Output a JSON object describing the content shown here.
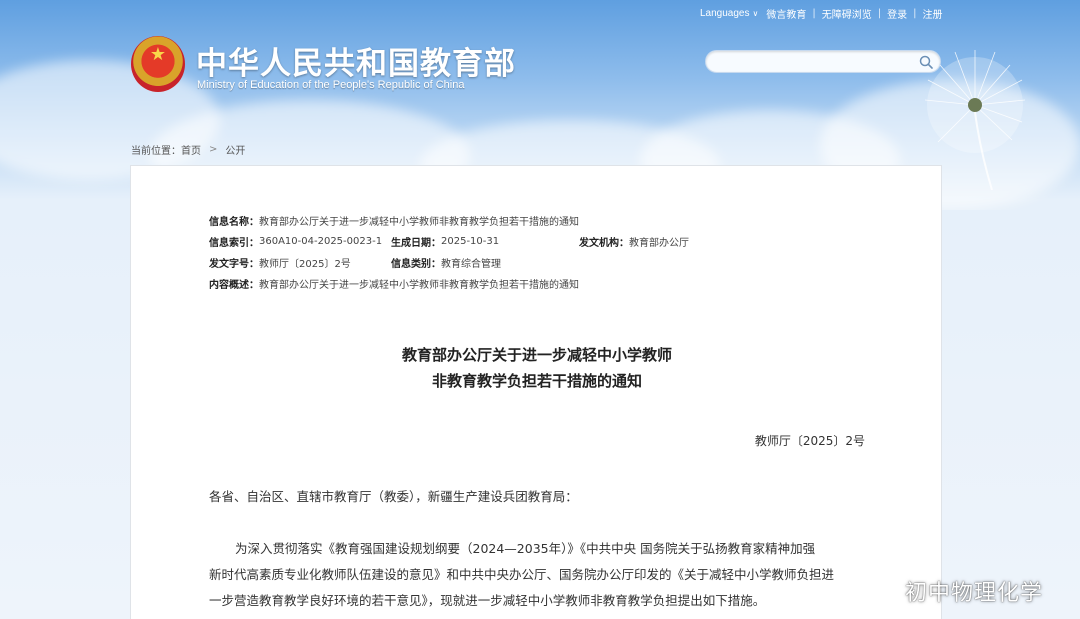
{
  "header": {
    "links": {
      "languages": "Languages",
      "weibo": "微言教育",
      "accessibility": "无障碍浏览",
      "login": "登录",
      "register": "注册"
    },
    "site_title": "中华人民共和国教育部",
    "site_subtitle": "Ministry of Education of the People's Republic of China",
    "search_placeholder": ""
  },
  "breadcrumb": {
    "label": "当前位置：",
    "home": "首页",
    "current": "公开"
  },
  "meta": {
    "name_key": "信息名称：",
    "name_value": "教育部办公厅关于进一步减轻中小学教师非教育教学负担若干措施的通知",
    "index_key": "信息索引：",
    "index_value": "360A10-04-2025-0023-1",
    "date_key": "生成日期：",
    "date_value": "2025-10-31",
    "issuer_key": "发文机构：",
    "issuer_value": "教育部办公厅",
    "docno_key": "发文字号：",
    "docno_value": "教师厅〔2025〕2号",
    "category_key": "信息类别：",
    "category_value": "教育综合管理",
    "summary_key": "内容概述：",
    "summary_value": "教育部办公厅关于进一步减轻中小学教师非教育教学负担若干措施的通知"
  },
  "document": {
    "title_line1": "教育部办公厅关于进一步减轻中小学教师",
    "title_line2": "非教育教学负担若干措施的通知",
    "number": "教师厅〔2025〕2号",
    "greeting": "各省、自治区、直辖市教育厅（教委），新疆生产建设兵团教育局：",
    "body_line1": "为深入贯彻落实《教育强国建设规划纲要（2024—2035年）》《中共中央 国务院关于弘扬教育家精神加强",
    "body_line2": "新时代高素质专业化教师队伍建设的意见》和中共中央办公厅、国务院办公厅印发的《关于减轻中小学教师负担进",
    "body_line3": "一步营造教育教学良好环境的若干意见》，现就进一步减轻中小学教师非教育教学负担提出如下措施。"
  },
  "watermark": "初中物理化学",
  "colors": {
    "header_blue": "#5f9fe0",
    "panel_bg": "#ffffff",
    "text": "#333333"
  }
}
